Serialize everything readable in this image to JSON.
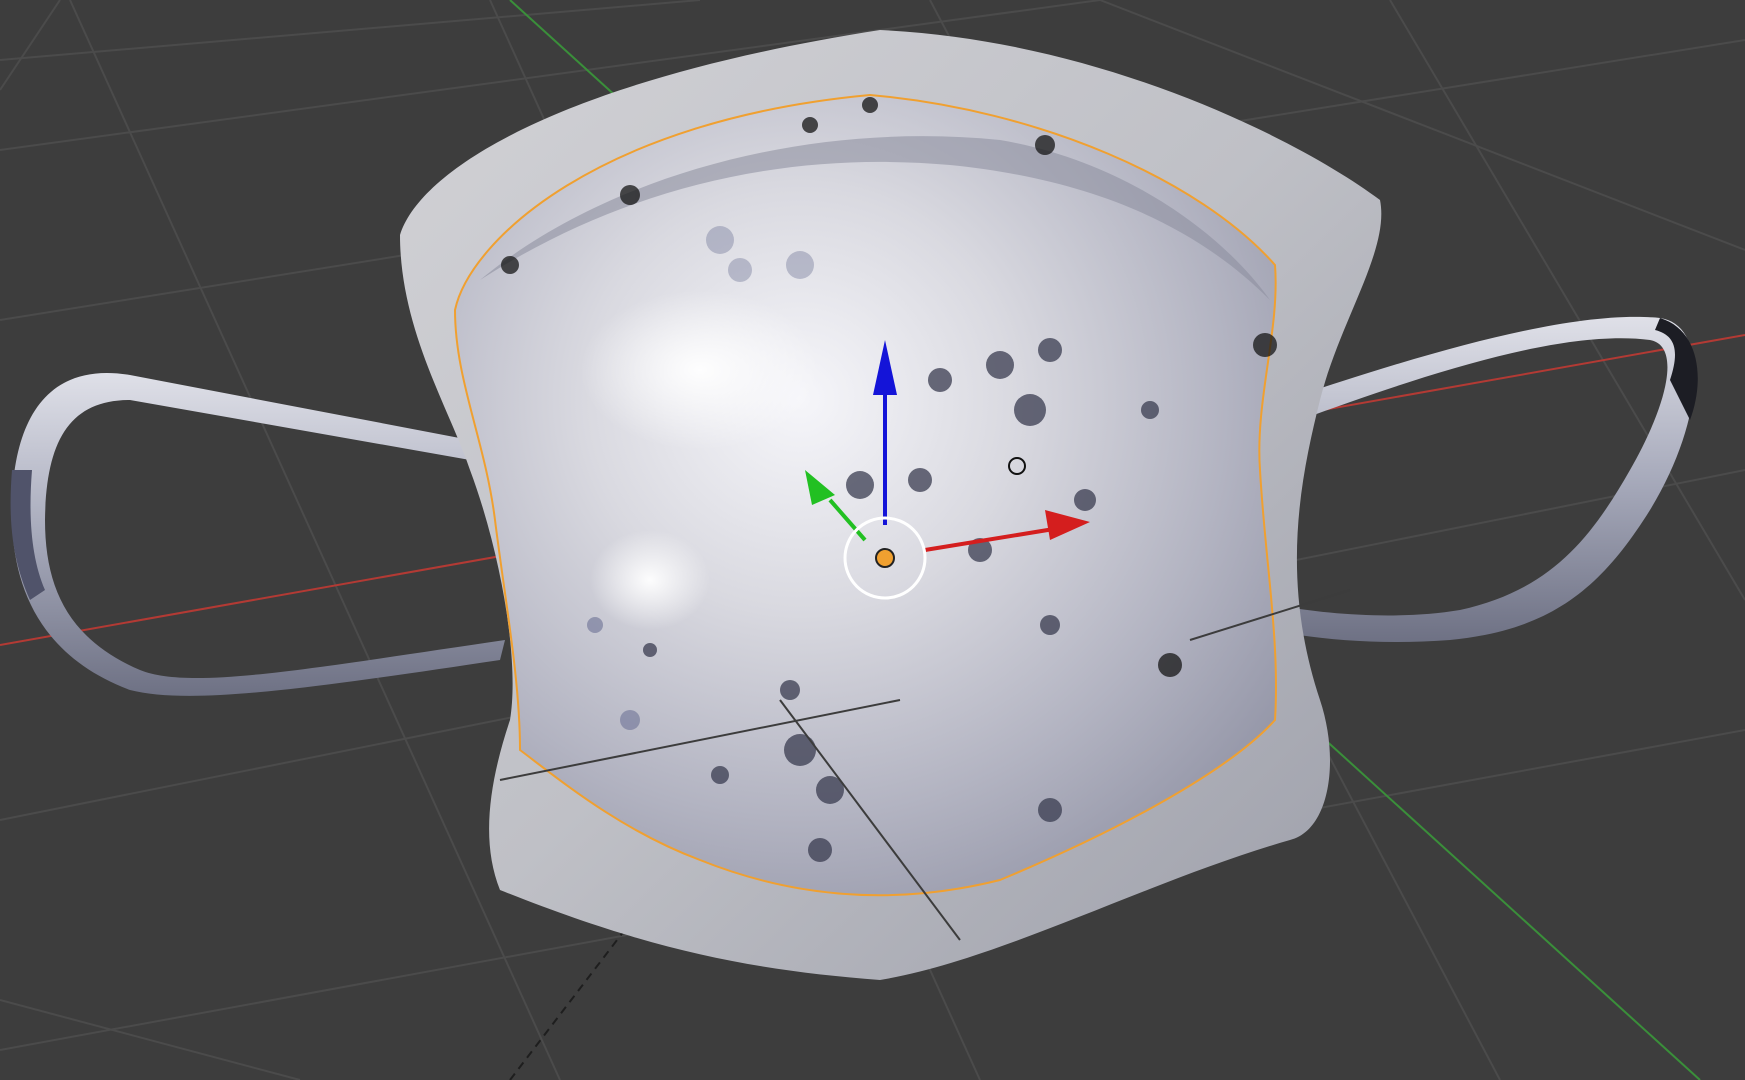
{
  "viewport": {
    "background": "#3d3d3d",
    "grid_color": "#4a4a4a",
    "axis_x_color": "#c0392b",
    "axis_y_color": "#2e9a2e",
    "selection_outline_color": "#f0a030"
  },
  "scene": {
    "object": "face-mask-mesh",
    "selected": true,
    "texture": "grayscale-with-dark-speckles"
  },
  "gizmo": {
    "type": "translate",
    "x_arrow_color": "#d41e1e",
    "y_arrow_color": "#22c022",
    "z_arrow_color": "#1414d8",
    "pivot_color": "#f0a030"
  },
  "icons": {
    "object_origin": "origin-dot-icon",
    "light_marker": "light-point-icon"
  }
}
